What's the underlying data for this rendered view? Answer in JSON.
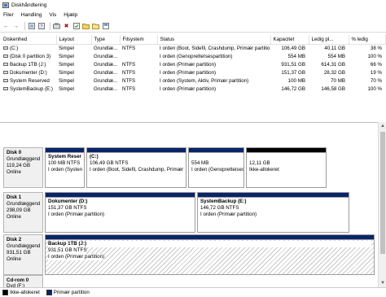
{
  "window": {
    "title": "Diskhåndtering"
  },
  "menu": [
    "Filer",
    "Handling",
    "Vis",
    "Hjælp"
  ],
  "toolbar": {
    "icons": [
      "back-arrow-icon",
      "forward-arrow-icon",
      "properties-icon",
      "help-icon",
      "refresh-icon",
      "delete-icon",
      "check-icon",
      "open-folder-icon",
      "explore-icon",
      "properties-sheet-icon"
    ]
  },
  "volume_table": {
    "columns": [
      "Diskenhed",
      "Layout",
      "Type",
      "Filsystem",
      "Status",
      "Kapacitet",
      "Ledig pl...",
      "% ledig"
    ],
    "rows": [
      [
        "(C:)",
        "Simpel",
        "Grundlæ...",
        "NTFS",
        "I orden (Boot, Sidefil, Crashdump, Primær partitio",
        "106,49 GB",
        "40,11 GB",
        "38 %"
      ],
      [
        "(Disk 0 partition 3)",
        "Simpel",
        "Grundlæ...",
        "",
        "I orden (GenopretteIsespartition)",
        "554 MB",
        "554 MB",
        "100 %"
      ],
      [
        "Backup 1TB (J:)",
        "Simpel",
        "Grundlæ...",
        "NTFS",
        "I orden (Primær partition)",
        "931,51 GB",
        "614,31 GB",
        "66 %"
      ],
      [
        "Dokumenter (D:)",
        "Simpel",
        "Grundlæ...",
        "NTFS",
        "I orden (Primær partition)",
        "151,37 GB",
        "28,32 GB",
        "19 %"
      ],
      [
        "System Reserved",
        "Simpel",
        "Grundlæ...",
        "NTFS",
        "I orden (System, Aktiv, Primær partition)",
        "100 MB",
        "70 MB",
        "70 %"
      ],
      [
        "SystemBackup (E:)",
        "Simpel",
        "Grundlæ...",
        "NTFS",
        "I orden (Primær partition)",
        "146,72 GB",
        "146,58 GB",
        "100 %"
      ]
    ]
  },
  "disks": [
    {
      "name": "Disk 0",
      "type": "Grundlæggend",
      "size": "119,24 GB",
      "state": "Online",
      "partitions": [
        {
          "name": "System Reser",
          "detail": "100 MB NTFS",
          "status": "I orden (Systen",
          "kind": "primary"
        },
        {
          "name": "(C:)",
          "detail": "106,49 GB NTFS",
          "status": "I orden (Boot, Sidefil, Crashdump, Primær",
          "kind": "primary"
        },
        {
          "name": "",
          "detail": "554 MB",
          "status": "I orden (Genopretteisespa",
          "kind": "primary"
        },
        {
          "name": "",
          "detail": "12,11 GB",
          "status": "Ikke-allokeret",
          "kind": "unallocated"
        }
      ]
    },
    {
      "name": "Disk 1",
      "type": "Grundlæggend",
      "size": "298,09 GB",
      "state": "Online",
      "partitions": [
        {
          "name": "Dokumenter (D:)",
          "detail": "151,37 GB NTFS",
          "status": "I orden (Primær partition)",
          "kind": "primary"
        },
        {
          "name": "SystemBackup (E:)",
          "detail": "146,72 GB NTFS",
          "status": "I orden (Primær partition)",
          "kind": "primary"
        }
      ]
    },
    {
      "name": "Disk 2",
      "type": "Grundlæggend",
      "size": "931,51 GB",
      "state": "Online",
      "partitions": [
        {
          "name": "Backup 1TB (J:)",
          "detail": "931,51 GB NTFS",
          "status": "I orden (Primær partition)",
          "kind": "primary-selected"
        }
      ]
    }
  ],
  "cdrom": {
    "name": "Cd-rom 0",
    "type": "Dvd (F:)"
  },
  "legend": [
    {
      "label": "Ikke-allokeret",
      "color": "#000000"
    },
    {
      "label": "Primær partition",
      "color": "#0a246a"
    }
  ]
}
